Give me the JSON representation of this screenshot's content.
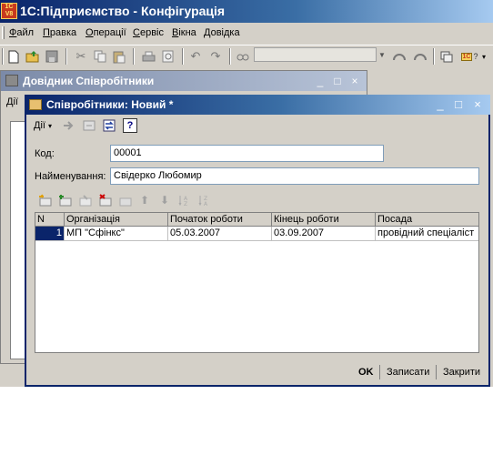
{
  "app": {
    "title": "1С:Підприємство - Конфігурація",
    "logo_text": "1С V8",
    "menu": [
      "Файл",
      "Правка",
      "Операції",
      "Сервіс",
      "Вікна",
      "Довідка"
    ],
    "menu_underline": [
      "Ф",
      "П",
      "О",
      "С",
      "В",
      "Д"
    ]
  },
  "toolbar": {
    "icons": [
      "new-icon",
      "open-icon",
      "save-icon",
      "cut-icon",
      "copy-icon",
      "paste-icon",
      "print-icon",
      "preview-icon",
      "undo-icon",
      "redo-icon",
      "find-icon",
      "search-combo",
      "find-next-icon",
      "find-prev-icon",
      "windows-icon",
      "1c-help-icon"
    ],
    "help_label": "1С"
  },
  "background_window": {
    "title": "Довідник Співробітники",
    "actions_label": "Дії",
    "buttons": [
      "_",
      "□",
      "×"
    ]
  },
  "form": {
    "title": "Співробітники: Новий *",
    "actions_label": "Дії",
    "help_label": "?",
    "buttons": [
      "_",
      "□",
      "×"
    ],
    "code_label": "Код:",
    "code_value": "00001",
    "name_label": "Найменування:",
    "name_value": "Свідерко Любомир",
    "table": {
      "columns": [
        "N",
        "Організація",
        "Початок роботи",
        "Кінець роботи",
        "Посада"
      ],
      "rows": [
        [
          "1",
          "МП \"Сфінкс\"",
          "05.03.2007",
          "03.09.2007",
          "провідний спеціаліст"
        ]
      ]
    },
    "footer": {
      "ok": "OK",
      "save": "Записати",
      "close": "Закрити"
    }
  },
  "colors": {
    "active_caption": "#0a246a",
    "inactive_caption": "#7b8aa8",
    "face": "#d4d0c8",
    "selection": "#0a246a"
  }
}
